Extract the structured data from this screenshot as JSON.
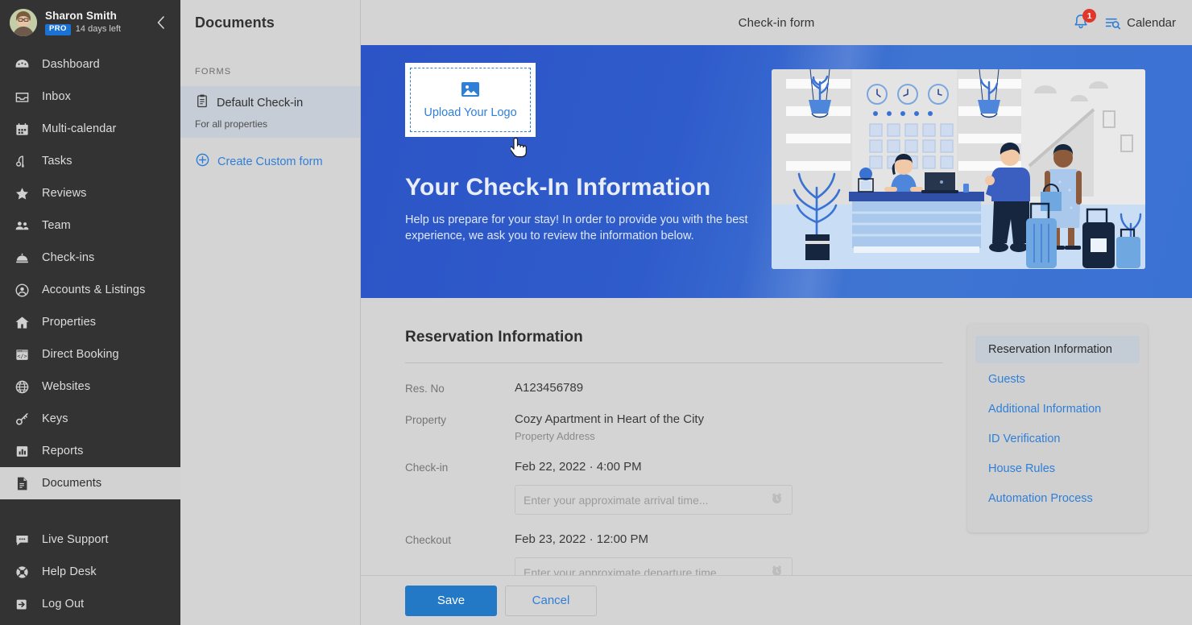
{
  "sidebar": {
    "profile": {
      "name": "Sharon Smith",
      "badge": "PRO",
      "days_left": "14 days left",
      "avatar_name": "user-avatar",
      "collapse_icon": "chevron-left-icon"
    },
    "items": [
      {
        "label": "Dashboard",
        "icon": "dashboard-icon",
        "active": false
      },
      {
        "label": "Inbox",
        "icon": "inbox-icon",
        "active": false
      },
      {
        "label": "Multi-calendar",
        "icon": "calendar-icon",
        "active": false
      },
      {
        "label": "Tasks",
        "icon": "tasks-icon",
        "active": false
      },
      {
        "label": "Reviews",
        "icon": "star-icon",
        "active": false
      },
      {
        "label": "Team",
        "icon": "team-icon",
        "active": false
      },
      {
        "label": "Check-ins",
        "icon": "bell-desk-icon",
        "active": false
      },
      {
        "label": "Accounts & Listings",
        "icon": "account-circle-icon",
        "active": false
      },
      {
        "label": "Properties",
        "icon": "home-icon",
        "active": false
      },
      {
        "label": "Direct Booking",
        "icon": "code-window-icon",
        "active": false
      },
      {
        "label": "Websites",
        "icon": "globe-icon",
        "active": false
      },
      {
        "label": "Keys",
        "icon": "key-icon",
        "active": false
      },
      {
        "label": "Reports",
        "icon": "bar-chart-icon",
        "active": false
      },
      {
        "label": "Documents",
        "icon": "document-icon",
        "active": true
      }
    ],
    "bottom_items": [
      {
        "label": "Live Support",
        "icon": "chat-bubble-icon"
      },
      {
        "label": "Help Desk",
        "icon": "lifebuoy-icon"
      },
      {
        "label": "Log Out",
        "icon": "logout-icon"
      }
    ]
  },
  "documents_panel": {
    "title": "Documents",
    "section_label": "FORMS",
    "form": {
      "name": "Default Check-in",
      "subtitle": "For all properties",
      "icon": "clipboard-icon"
    },
    "create": {
      "label": "Create Custom form",
      "icon": "plus-circle-icon"
    }
  },
  "topbar": {
    "title": "Check-in form",
    "notification_icon": "bell-icon",
    "notification_count": "1",
    "calendar_icon": "list-search-icon",
    "calendar_label": "Calendar"
  },
  "hero": {
    "upload": {
      "label": "Upload Your Logo",
      "icon": "image-placeholder-icon"
    },
    "heading": "Your Check-In Information",
    "paragraph": "Help us prepare for your stay!  In order to provide you with the best experience, we ask you to review the information below.",
    "illustration_name": "hotel-lobby-reception-illustration",
    "gradient_from": "#2c54c6",
    "gradient_to": "#3a72d4"
  },
  "form": {
    "heading": "Reservation Information",
    "rows": [
      {
        "label": "Res. No",
        "value": "A123456789",
        "sub": null,
        "input": null
      },
      {
        "label": "Property",
        "value": "Cozy Apartment in Heart of the City",
        "sub": "Property Address",
        "input": null
      },
      {
        "label": "Check-in",
        "value": "Feb 22, 2022 · 4:00 PM",
        "sub": null,
        "input": "Enter your approximate arrival time..."
      },
      {
        "label": "Checkout",
        "value": "Feb 23, 2022 · 12:00 PM",
        "sub": null,
        "input": "Enter your approximate departure time..."
      }
    ],
    "input_icon": "alarm-clock-icon"
  },
  "side_nav": {
    "items": [
      {
        "label": "Reservation Information",
        "active": true
      },
      {
        "label": "Guests",
        "active": false
      },
      {
        "label": "Additional Information",
        "active": false
      },
      {
        "label": "ID Verification",
        "active": false
      },
      {
        "label": "House Rules",
        "active": false
      },
      {
        "label": "Automation Process",
        "active": false
      }
    ]
  },
  "actions": {
    "save_label": "Save",
    "cancel_label": "Cancel",
    "save_color": "#2379c5",
    "link_color": "#2f7fd8"
  }
}
